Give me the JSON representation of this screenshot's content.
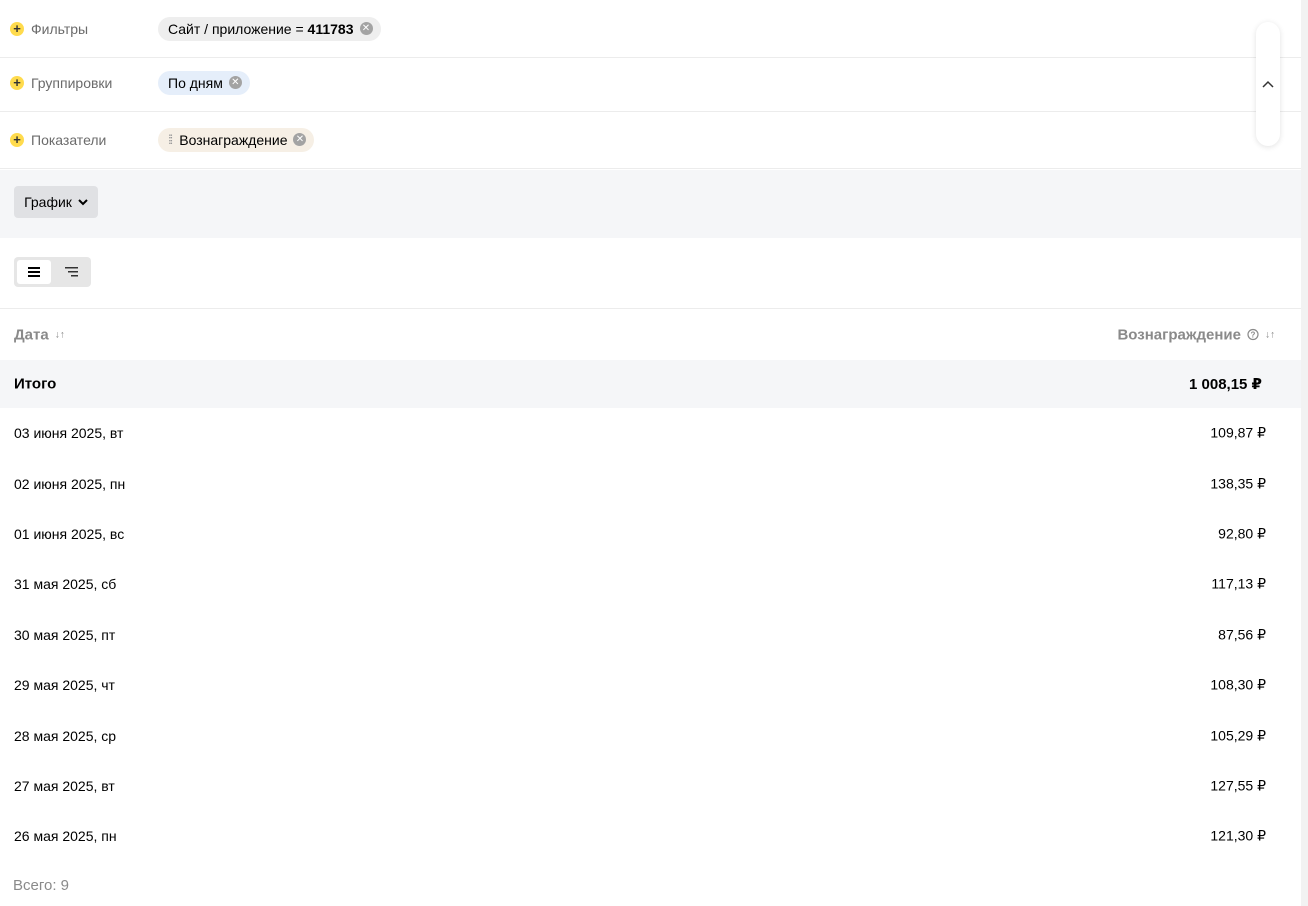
{
  "filters": {
    "filters_label": "Фильтры",
    "filter_chip_text": "Сайт / приложение = ",
    "filter_chip_value": "411783",
    "groupings_label": "Группировки",
    "grouping_chip": "По дням",
    "metrics_label": "Показатели",
    "metric_chip": "Вознаграждение"
  },
  "view": {
    "chart_button": "График"
  },
  "table": {
    "col_date": "Дата",
    "col_reward": "Вознаграждение",
    "total_label": "Итого",
    "total_value": "1 008,15 ₽",
    "rows": [
      {
        "date": "03 июня 2025, вт",
        "value": "109,87 ₽"
      },
      {
        "date": "02 июня 2025, пн",
        "value": "138,35 ₽"
      },
      {
        "date": "01 июня 2025, вс",
        "value": "92,80 ₽"
      },
      {
        "date": "31 мая 2025, сб",
        "value": "117,13 ₽"
      },
      {
        "date": "30 мая 2025, пт",
        "value": "87,56 ₽"
      },
      {
        "date": "29 мая 2025, чт",
        "value": "108,30 ₽"
      },
      {
        "date": "28 мая 2025, ср",
        "value": "105,29 ₽"
      },
      {
        "date": "27 мая 2025, вт",
        "value": "127,55 ₽"
      },
      {
        "date": "26 мая 2025, пн",
        "value": "121,30 ₽"
      }
    ]
  },
  "footer": {
    "count_text": "Всего: 9"
  },
  "colors": {
    "accent_yellow": "#ffdb4d",
    "band_grey": "#f5f6f8"
  }
}
